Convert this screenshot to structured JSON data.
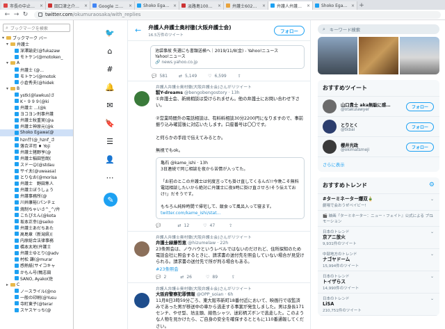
{
  "browser": {
    "tabs": [
      {
        "title": "市長の中止理由ではつきり",
        "color": "#d44"
      },
      {
        "title": "田口津之介公式サイト",
        "color": "#c33"
      },
      {
        "title": "Google ニュース",
        "color": "#4285f4"
      },
      {
        "title": "Shoko Egawa(@Sho",
        "color": "#1da1f2"
      },
      {
        "title": "淡路島100メートル",
        "color": "#c33"
      },
      {
        "title": "弁護士602人が声明",
        "color": "#e8a33d"
      },
      {
        "title": "弁護人弁護士奥村",
        "color": "#1da1f2",
        "active": true
      },
      {
        "title": "Shoko Egawa(@Sho",
        "color": "#1da1f2"
      }
    ],
    "url_host": "twitter.com",
    "url_path": "/okumuraosaka/with_replies",
    "back_icon": "arrow-left-icon",
    "forward_icon": "arrow-right-icon",
    "reload_icon": "reload-icon"
  },
  "bookmarks": {
    "search_placeholder": "ブックマークを検索",
    "items": [
      {
        "label": "ブックマーク バー",
        "type": "folder",
        "indent": 0,
        "twist": "▾"
      },
      {
        "label": "弁護士",
        "type": "folder",
        "indent": 1,
        "twist": "▾"
      },
      {
        "label": "深澤諭史(@fukazaw",
        "type": "tw",
        "indent": 2
      },
      {
        "label": "モトケン(@motoken_",
        "type": "tw",
        "indent": 2
      },
      {
        "label": "A",
        "type": "folder",
        "indent": 1,
        "twist": "▾"
      },
      {
        "label": "弁護士 (@...",
        "type": "tw",
        "indent": 2
      },
      {
        "label": "モトケン(@motok",
        "type": "tw",
        "indent": 2
      },
      {
        "label": "小倉秀夫(@hidek",
        "type": "tw",
        "indent": 2
      },
      {
        "label": "B",
        "type": "folder",
        "indent": 1,
        "twist": "▾"
      },
      {
        "label": "ystk(@lawkus)さ",
        "type": "tw",
        "indent": 2
      },
      {
        "label": "K・９９９(@ki",
        "type": "tw",
        "indent": 2
      },
      {
        "label": "弁護士 ...(@k",
        "type": "tw",
        "indent": 2
      },
      {
        "label": "ヨコヨン刑事弁護",
        "type": "tw",
        "indent": 2
      },
      {
        "label": "弁護士秋重実(@a",
        "type": "tw",
        "indent": 2
      },
      {
        "label": "弁護士神原元(@k",
        "type": "tw",
        "indent": 2
      },
      {
        "label": "Shoko Egawa(@",
        "type": "tw",
        "indent": 2,
        "selected": true
      },
      {
        "label": "hzn什(@_hznf_さ",
        "type": "tw",
        "indent": 2
      },
      {
        "label": "落合洋司 ♦ Yoji",
        "type": "tw",
        "indent": 2
      },
      {
        "label": "弁護士猪野亨(@",
        "type": "tw",
        "indent": 2
      },
      {
        "label": "弁護士稲田哲朗(",
        "type": "tw",
        "indent": 2
      },
      {
        "label": "スドー☺(@stdau",
        "type": "tw",
        "indent": 2
      },
      {
        "label": "サイ太(@uwaasa)",
        "type": "tw",
        "indent": 2
      },
      {
        "label": "とりなお(@morisa",
        "type": "tw",
        "indent": 2
      },
      {
        "label": "弁護士　野田隼人",
        "type": "tw",
        "indent": 2
      },
      {
        "label": "弁護士ぼうしょう",
        "type": "tw",
        "indent": 2
      },
      {
        "label": "弁護事務所(@",
        "type": "tw",
        "indent": 2
      },
      {
        "label": "川井康裕(パンチェ",
        "type": "tw",
        "indent": 2
      },
      {
        "label": "焼制ちゃいさ^_^/弁",
        "type": "tw",
        "indent": 2
      },
      {
        "label": "こたぴえん(@kota",
        "type": "tw",
        "indent": 2
      },
      {
        "label": "坂本正幸(@seiko",
        "type": "tw",
        "indent": 2
      },
      {
        "label": "弁護士あだちあた",
        "type": "tw",
        "indent": 2
      },
      {
        "label": "高島章（新潟県)(",
        "type": "tw",
        "indent": 2
      },
      {
        "label": "内原総合法律事務",
        "type": "tw",
        "indent": 2
      },
      {
        "label": "橋本太地(弁護士",
        "type": "tw",
        "indent": 2
      },
      {
        "label": "弁護士ゆとり(@adv",
        "type": "tw",
        "indent": 2
      },
      {
        "label": "村松 謙(@murar",
        "type": "tw",
        "indent": 2
      },
      {
        "label": "感熱紙(サイコキャ",
        "type": "tw",
        "indent": 2
      },
      {
        "label": "かもん号(鴨志田",
        "type": "tw",
        "indent": 2
      },
      {
        "label": "SANO, Ayako(佐",
        "type": "tw",
        "indent": 2
      },
      {
        "label": "C",
        "type": "folder",
        "indent": 1,
        "twist": "▸"
      },
      {
        "label": "ノースライル(@no",
        "type": "tw",
        "indent": 2
      },
      {
        "label": "一般の印刷(@Yusu",
        "type": "tw",
        "indent": 2
      },
      {
        "label": "寺町東子(@terar",
        "type": "tw",
        "indent": 2
      },
      {
        "label": "スヤスヤっち(@",
        "type": "tw",
        "indent": 2
      }
    ]
  },
  "nav": {
    "icons": [
      "twitter-logo-icon",
      "home-icon",
      "hashtag-icon",
      "bell-icon",
      "mail-icon",
      "bookmark-icon",
      "list-icon",
      "profile-icon",
      "more-icon"
    ],
    "glyphs": [
      "🐦",
      "⌂",
      "#",
      "🔔",
      "✉",
      "🔖",
      "☰",
      "👤",
      "⋯"
    ],
    "tweet_glyph": "✎"
  },
  "profile": {
    "back": "←",
    "name": "弁護人弁護士奥村徹(大阪弁護士会)",
    "count": "16.5万件のツイート",
    "follow": "フォロー"
  },
  "top_card": {
    "line1": "池袋事故 失選にも書類送検へ｜2019/11/8(金) - Yahoo!ニュース",
    "line2": "Yahoo!ニュース",
    "src": "🔗 news.yahoo.co.jp",
    "reply": "581",
    "retweet": "5,149",
    "like": "6,599"
  },
  "tweets": [
    {
      "rt": "弁護人弁護士奥村徹(大阪弁護士会)さんがリツイート",
      "name": "㍿Y-dreams",
      "handle": "@bengobengostory · 13h",
      "avatar": "#3a7a3a",
      "body": "①弁護士会、新規相談は受けられません。他の弁護士にお問い合わせ下さい。\n\n②営業時間外の電話相談は、有料料相談30分2200円になりますので、事前振り込み確認後に対応いたします。口座番号は〇〇です。\n\nと何らかの手段で伝えてみるとか。\n\n無視でもok。",
      "quote_name": "亀石 @kame_ishi · 13h",
      "quote": "3日連続で同じ相談を夜から苦情が入ってた。\n\n「お前のとこの弁護士は何度言っても掛け直してくるんだ!!今晩こそ無料電話相談したいから絶対に弁護士に夜9時に掛け直させろ!そう伝えておけ!」だそうです。\n\nもちろん純粋時間で帰宅して、飯食って風呂入って寝ます。",
      "quote_link": "twitter.com/kame_ishi/stat...",
      "reply": "",
      "retweet": "12",
      "like": "47"
    },
    {
      "rt": "弁護人弁護士奥村徹(大阪弁護士会)さんがリツイート",
      "name": "弁護士緑藤哲恵",
      "handle": "@hizumelaw · 22h",
      "avatar": "#8b6f5a",
      "body": "23条照会は、ノウハウというレベルではないのだけれど、住所探知のため電話会社に照会するときに、請求書の送付先を照会していない場合が見受けられる。請求書の送付先で所が判る場合もある。",
      "tag": "#23条照会",
      "reply": "2",
      "retweet": "26",
      "like": "89"
    },
    {
      "rt": "弁護人弁護士奥村徹(大阪弁護士会)さんがリツイート",
      "name": "大阪府警察犯罪情報",
      "handle": "@OPP_soian · 6h",
      "avatar": "#1e4d8c",
      "body": "11月8日3時59分ごろ、東大阪市新町18番付近において、映画行で収監済みであった男が移送中の車から逃走する事案が発生しました。男は身長171センチ、やせ型、坊主頭、紺色シャツ、迷彩柄ズボンで逃走した。このような人物を見かけたら、ご自身の安全を確保するとともに110番通報してください。",
      "reply": "66",
      "retweet": "1,760",
      "like": "759"
    }
  ],
  "right": {
    "search_placeholder": "キーワード検索",
    "who_title": "おすすめツイート",
    "who": [
      {
        "name": "山口貴士 aka無駄に感…",
        "handle": "@otakulawyer",
        "color": "#6b6b6b"
      },
      {
        "name": "とりとく",
        "handle": "@tkbai",
        "color": "#2c3e6e"
      },
      {
        "name": "櫻井光政",
        "handle": "@okimatsmeji",
        "color": "#3a3a3a"
      }
    ],
    "follow": "フォロー",
    "more": "さらに表示",
    "trends_title": "おすすめトレンド",
    "trends": [
      {
        "cat": "",
        "title": "#ターミネーター爆双🎍",
        "note": "",
        "desc": "劇場で会おうぜベイビー!"
      },
      {
        "cat": "",
        "title": "",
        "note": "",
        "desc": "🎬 映画『ターミネーター：ニュー・フェイト』公式による プロモーション"
      },
      {
        "cat": "日本のトレンド",
        "title": "京アニ放火",
        "note": "9,931件のツイート",
        "desc": ""
      },
      {
        "cat": "中部地方のトレンド",
        "title": "ナゴヤドーム",
        "note": "15,994件のツイート",
        "desc": ""
      },
      {
        "cat": "日本のトレンド",
        "title": "トイザらス",
        "note": "14,990件のツイート",
        "desc": ""
      },
      {
        "cat": "日本のトレンド",
        "title": "LiSA",
        "note": "210,751件のツイート",
        "desc": ""
      }
    ]
  }
}
